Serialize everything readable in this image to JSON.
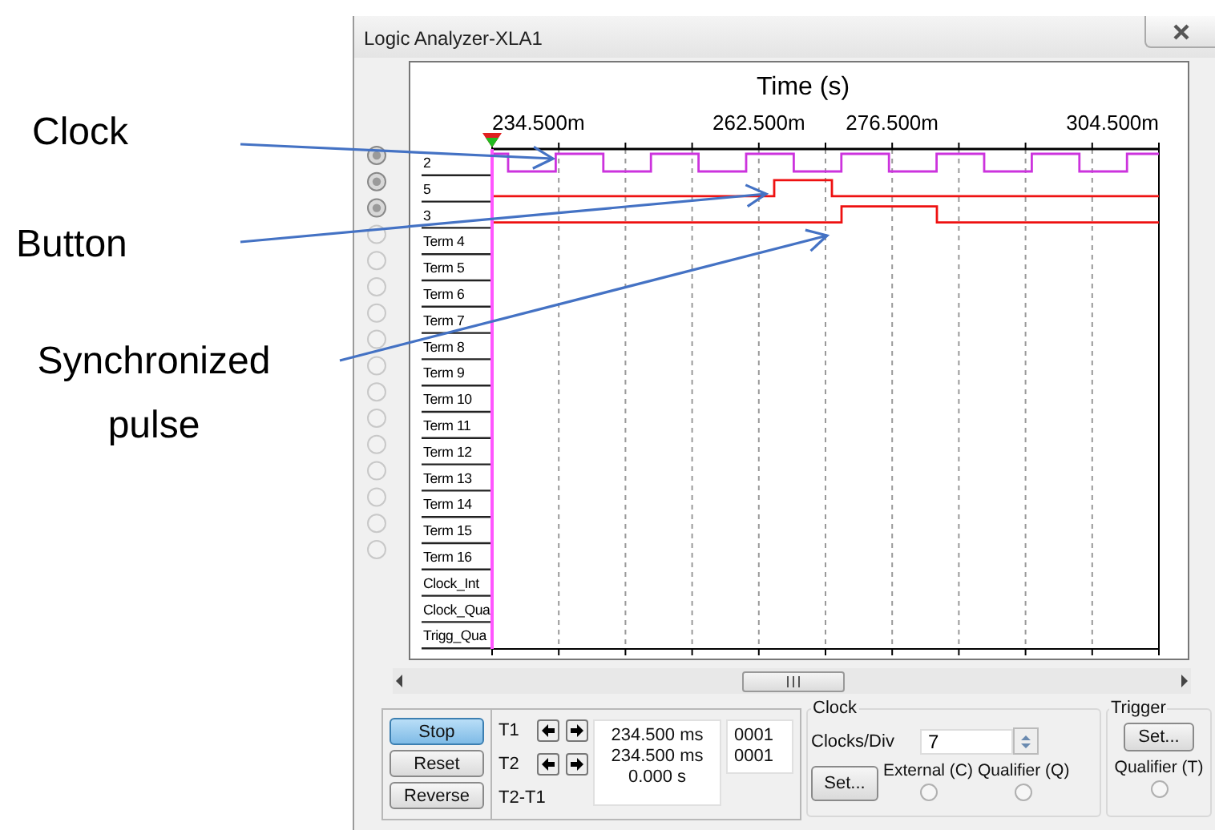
{
  "annotations": [
    {
      "text": "Clock"
    },
    {
      "text": "Button"
    },
    {
      "text": "Synchronized pulse"
    }
  ],
  "window": {
    "title": "Logic Analyzer-XLA1"
  },
  "time_axis": {
    "title": "Time (s)",
    "ticks": [
      "234.500m",
      "262.500m",
      "276.500m",
      "304.500m"
    ]
  },
  "channels": [
    {
      "label": "2",
      "kind": "input",
      "active": true,
      "color": "#cc33dd"
    },
    {
      "label": "5",
      "kind": "input",
      "active": true,
      "color": "#ee1111"
    },
    {
      "label": "3",
      "kind": "input",
      "active": true,
      "color": "#ee1111"
    },
    {
      "label": "Term 4",
      "kind": "input",
      "active": false
    },
    {
      "label": "Term 5",
      "kind": "input",
      "active": false
    },
    {
      "label": "Term 6",
      "kind": "input",
      "active": false
    },
    {
      "label": "Term 7",
      "kind": "input",
      "active": false
    },
    {
      "label": "Term 8",
      "kind": "input",
      "active": false
    },
    {
      "label": "Term 9",
      "kind": "input",
      "active": false
    },
    {
      "label": "Term 10",
      "kind": "input",
      "active": false
    },
    {
      "label": "Term 11",
      "kind": "input",
      "active": false
    },
    {
      "label": "Term 12",
      "kind": "input",
      "active": false
    },
    {
      "label": "Term 13",
      "kind": "input",
      "active": false
    },
    {
      "label": "Term 14",
      "kind": "input",
      "active": false
    },
    {
      "label": "Term 15",
      "kind": "input",
      "active": false
    },
    {
      "label": "Term 16",
      "kind": "input",
      "active": false
    },
    {
      "label": "Clock_Int",
      "kind": "control"
    },
    {
      "label": "Clock_Qua",
      "kind": "control"
    },
    {
      "label": "Trigg_Qua",
      "kind": "control"
    }
  ],
  "buttons": [
    {
      "label": "Stop",
      "selected": true
    },
    {
      "label": "Reset",
      "selected": false
    },
    {
      "label": "Reverse",
      "selected": false
    }
  ],
  "cursors": [
    {
      "label": "T1",
      "time": "234.500 ms",
      "value": "0001"
    },
    {
      "label": "T2",
      "time": "234.500 ms",
      "value": "0001"
    }
  ],
  "delta": {
    "label": "T2-T1",
    "time": "0.000 s"
  },
  "clock": {
    "title": "Clock",
    "clocks_per_div_label": "Clocks/Div",
    "clocks_per_div": "7",
    "set_button": "Set...",
    "sources": [
      {
        "label": "External (C)",
        "selected": false
      },
      {
        "label": "Qualifier (Q)",
        "selected": false
      }
    ]
  },
  "trigger": {
    "title": "Trigger",
    "set_button": "Set...",
    "qualifier": {
      "label": "Qualifier (T)",
      "selected": false
    }
  }
}
